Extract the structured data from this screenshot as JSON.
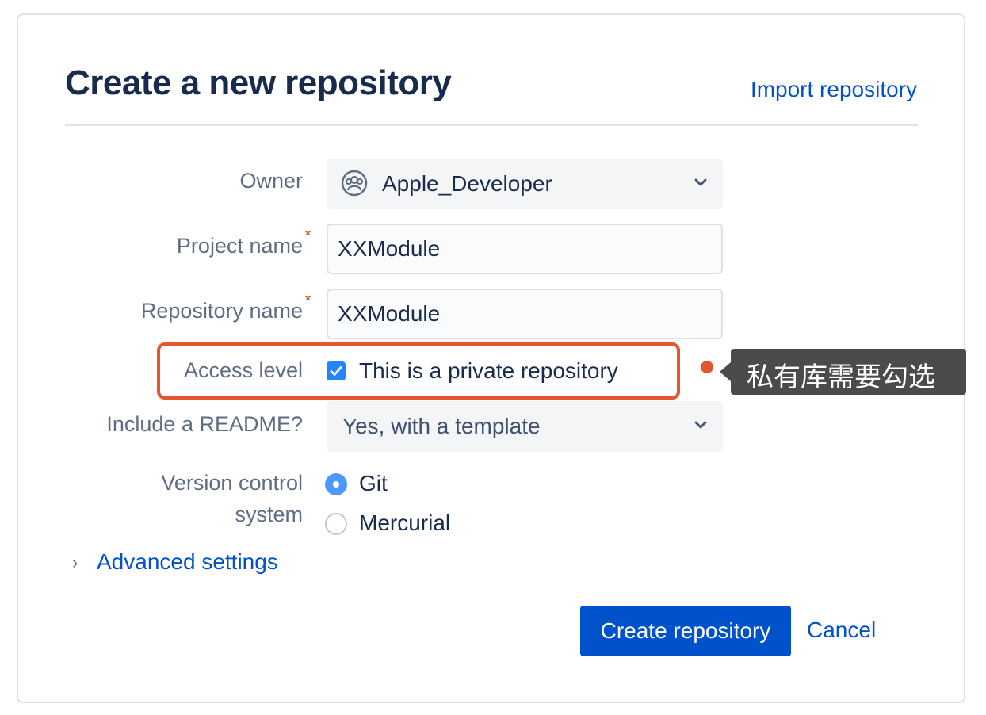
{
  "header": {
    "title": "Create a new repository",
    "import_link": "Import repository"
  },
  "form": {
    "owner": {
      "label": "Owner",
      "value": "Apple_Developer",
      "icon": "team-icon"
    },
    "project_name": {
      "label": "Project name",
      "required_mark": "*",
      "value": "XXModule"
    },
    "repository_name": {
      "label": "Repository name",
      "required_mark": "*",
      "value": "XXModule"
    },
    "access_level": {
      "label": "Access level",
      "checkbox_label": "This is a private repository",
      "checked": true
    },
    "readme": {
      "label": "Include a README?",
      "value": "Yes, with a template"
    },
    "vcs": {
      "label_line1": "Version control",
      "label_line2": "system",
      "options": [
        {
          "label": "Git",
          "selected": true
        },
        {
          "label": "Mercurial",
          "selected": false
        }
      ]
    },
    "advanced": {
      "label": "Advanced settings",
      "arrow": "›"
    }
  },
  "actions": {
    "create_label": "Create repository",
    "cancel_label": "Cancel"
  },
  "annotation": {
    "callout_text": "私有库需要勾选",
    "highlight_color": "#e4572e"
  },
  "colors": {
    "primary": "#0052cc",
    "text": "#172b4d",
    "muted": "#5e6c84",
    "checkbox": "#2684ff",
    "radio": "#4c9aff",
    "callout_bg": "#4b4b4b"
  }
}
